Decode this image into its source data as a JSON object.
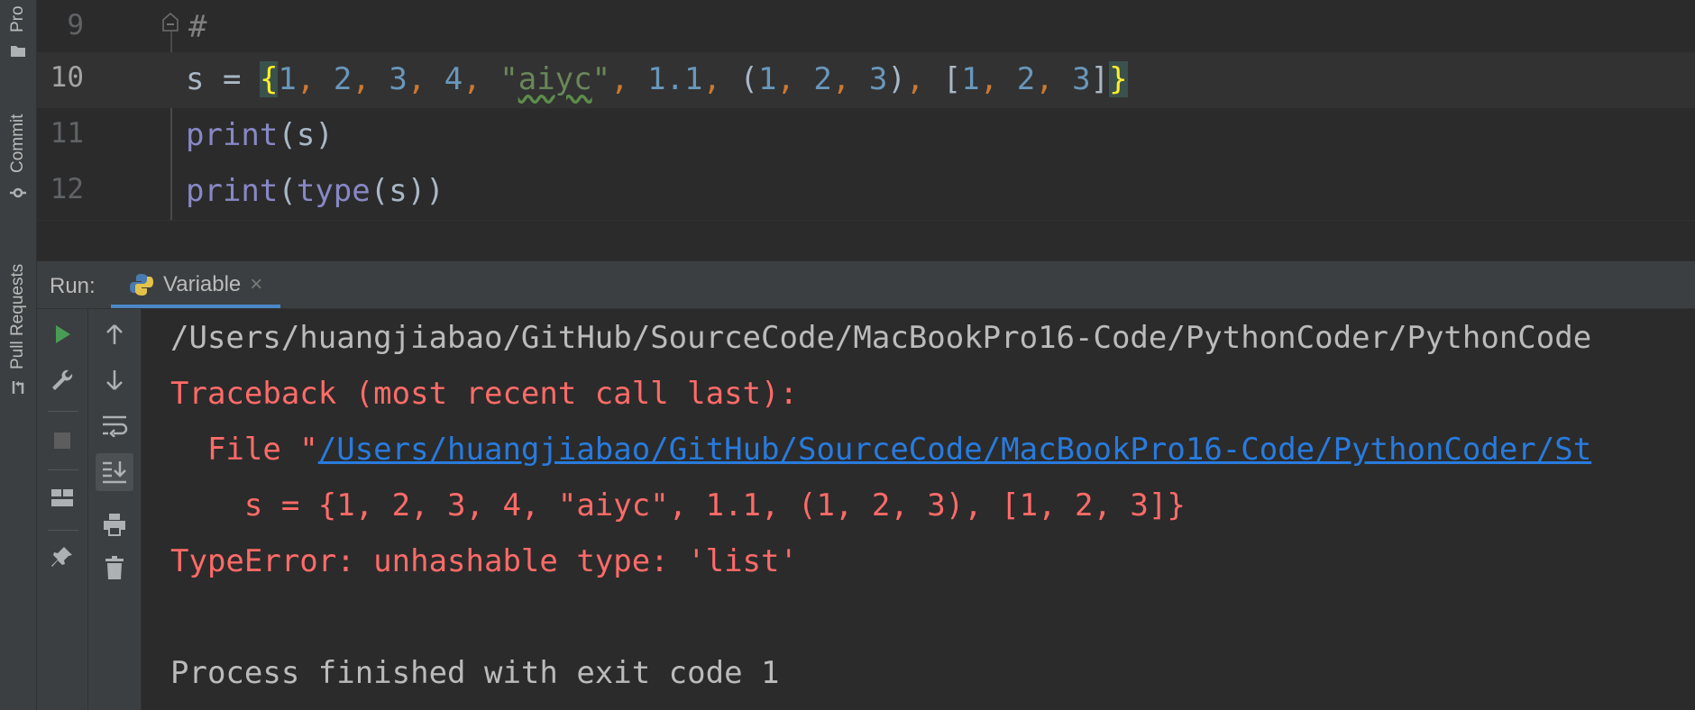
{
  "left_strip": {
    "tabs": [
      {
        "label": "Pro",
        "icon": "folder-icon"
      },
      {
        "label": "Commit",
        "icon": "commit-icon"
      },
      {
        "label": "Pull Requests",
        "icon": "pull-request-icon"
      }
    ]
  },
  "editor": {
    "lines": [
      {
        "number": "9",
        "text": "#"
      },
      {
        "number": "10",
        "text": "s = {1, 2, 3, 4, \"aiyc\", 1.1, (1, 2, 3), [1, 2, 3]}"
      },
      {
        "number": "11",
        "text": "print(s)"
      },
      {
        "number": "12",
        "text": "print(type(s))"
      }
    ],
    "current_line": "10"
  },
  "run_panel": {
    "label": "Run:",
    "tab_title": "Variable",
    "tab_icon": "python-icon",
    "toolbar_primary": [
      "run-icon",
      "wrench-icon",
      "stop-icon",
      "layout-icon",
      "pin-icon"
    ],
    "toolbar_secondary": [
      "arrow-up-icon",
      "arrow-down-icon",
      "soft-wrap-icon",
      "scroll-to-end-icon",
      "print-icon",
      "trash-icon"
    ]
  },
  "console": {
    "path_line": "/Users/huangjiabao/GitHub/SourceCode/MacBookPro16-Code/PythonCoder/PythonCode",
    "traceback_header": "Traceback (most recent call last):",
    "file_prefix": "  File \"",
    "file_link": "/Users/huangjiabao/GitHub/SourceCode/MacBookPro16-Code/PythonCoder/St",
    "source_line": "    s = {1, 2, 3, 4, \"aiyc\", 1.1, (1, 2, 3), [1, 2, 3]}",
    "error_line": "TypeError: unhashable type: 'list'",
    "exit_line": "Process finished with exit code 1"
  },
  "colors": {
    "background": "#2b2b2b",
    "error": "#ff6b68",
    "link": "#287bde",
    "run_green": "#499c54",
    "brace_highlight": "#ffef28"
  }
}
